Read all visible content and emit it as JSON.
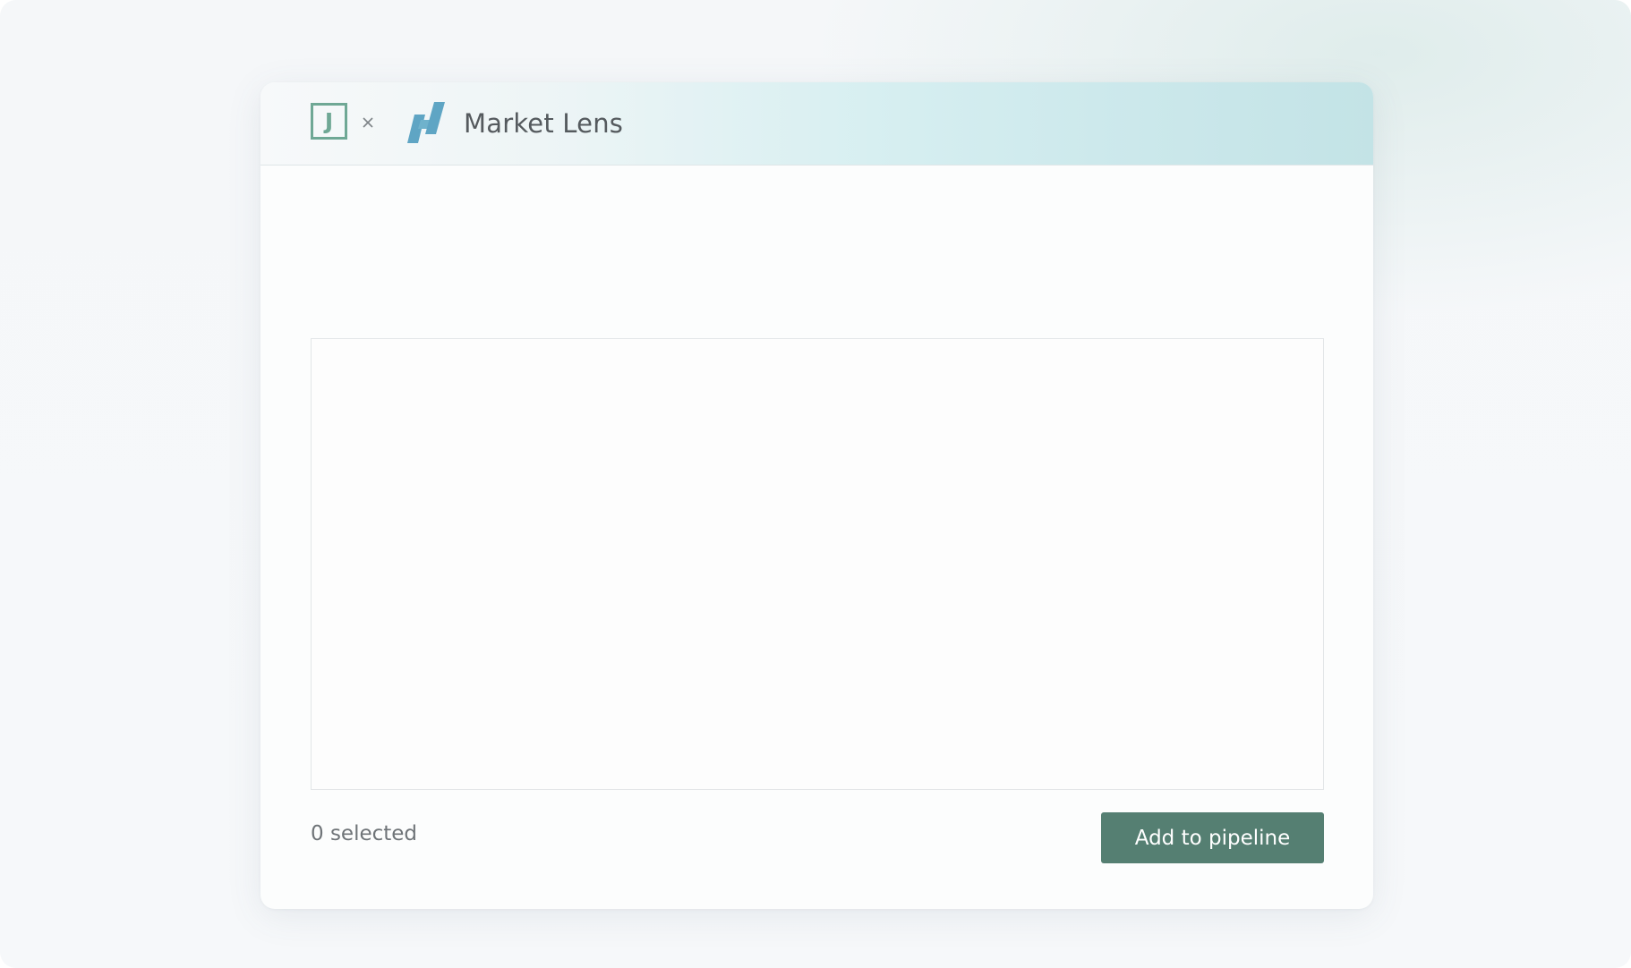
{
  "header": {
    "logo_letter": "J",
    "separator": "×",
    "title": "Market Lens",
    "left_logo_icon": "j-square-logo",
    "right_logo_icon": "market-lens-logo"
  },
  "footer": {
    "selected_count": "0 selected",
    "add_button_label": "Add to pipeline"
  },
  "colors": {
    "accent": "#557f72",
    "logo_green": "#6fa895",
    "logo_blue": "#5fa5c4",
    "header_gradient_end": "#c3e3e6"
  }
}
